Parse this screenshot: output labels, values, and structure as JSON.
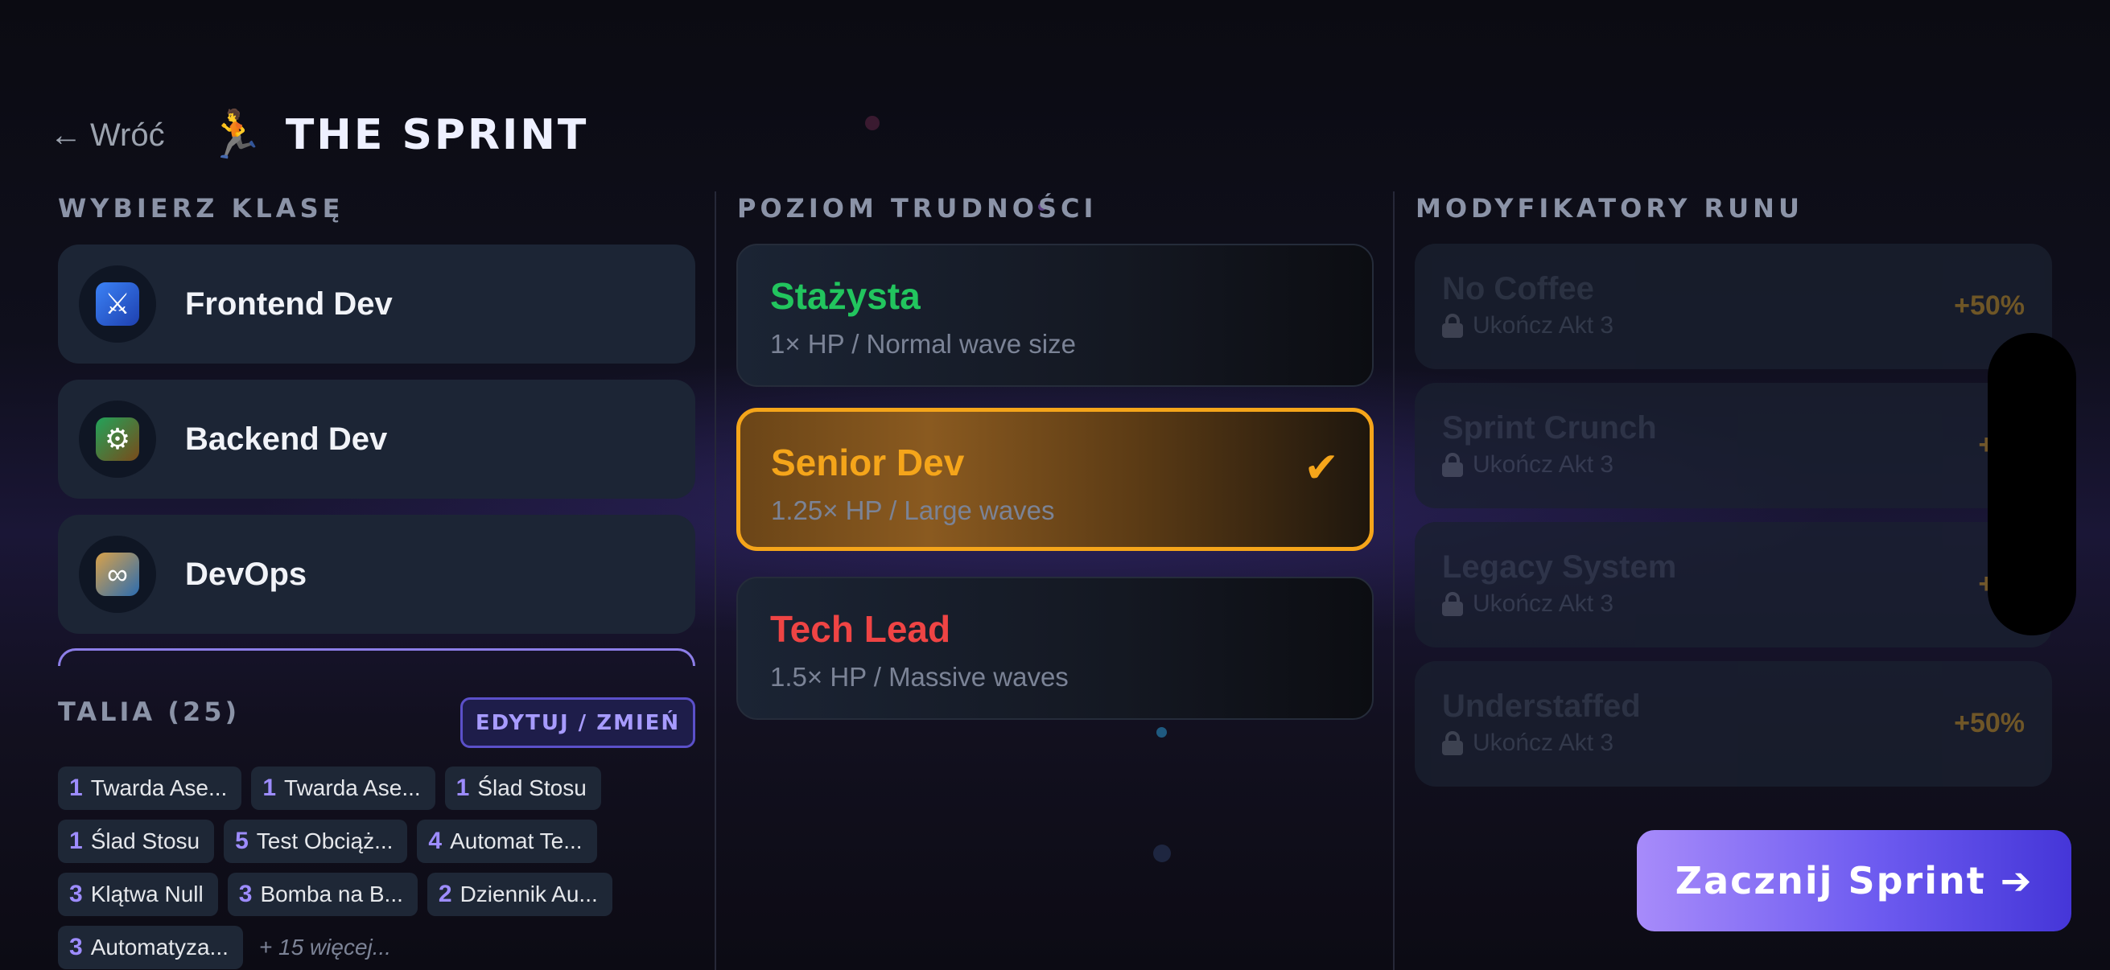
{
  "header": {
    "back_label": "Wróć",
    "back_arrow": "←",
    "runner_icon": "🏃",
    "title": "THE SPRINT"
  },
  "classes": {
    "heading": "WYBIERZ KLASĘ",
    "items": [
      {
        "name": "Frontend Dev",
        "icon": "sword-icon",
        "glyph": "⚔"
      },
      {
        "name": "Backend Dev",
        "icon": "gear-icon",
        "glyph": "⚙"
      },
      {
        "name": "DevOps",
        "icon": "infinity-icon",
        "glyph": "∞"
      }
    ]
  },
  "deck": {
    "title": "TALIA (25)",
    "edit_label": "EDYTUJ / ZMIEŃ",
    "rows": [
      [
        {
          "cost": "1",
          "name": "Twarda Ase..."
        },
        {
          "cost": "1",
          "name": "Twarda Ase..."
        },
        {
          "cost": "1",
          "name": "Ślad Stosu"
        }
      ],
      [
        {
          "cost": "1",
          "name": "Ślad Stosu"
        },
        {
          "cost": "5",
          "name": "Test Obciąż..."
        },
        {
          "cost": "4",
          "name": "Automat Te..."
        }
      ],
      [
        {
          "cost": "3",
          "name": "Klątwa Null"
        },
        {
          "cost": "3",
          "name": "Bomba na B..."
        },
        {
          "cost": "2",
          "name": "Dziennik Au..."
        }
      ],
      [
        {
          "cost": "3",
          "name": "Automatyza..."
        }
      ]
    ],
    "more": "+ 15 więcej..."
  },
  "difficulty": {
    "heading": "POZIOM TRUDNOŚCI",
    "items": [
      {
        "name": "Stażysta",
        "desc": "1× HP / Normal wave size",
        "color": "#22c55e"
      },
      {
        "name": "Senior Dev",
        "desc": "1.25× HP / Large waves",
        "color": "#f5a51a",
        "check": "✔"
      },
      {
        "name": "Tech Lead",
        "desc": "1.5× HP / Massive waves",
        "color": "#ef4444"
      }
    ]
  },
  "modifiers": {
    "heading": "MODYFIKATORY RUNU",
    "items": [
      {
        "name": "No Coffee",
        "lock": "Ukończ Akt 3",
        "bonus": "+50%"
      },
      {
        "name": "Sprint Crunch",
        "lock": "Ukończ Akt 3",
        "bonus": "+75"
      },
      {
        "name": "Legacy System",
        "lock": "Ukończ Akt 3",
        "bonus": "+25"
      },
      {
        "name": "Understaffed",
        "lock": "Ukończ Akt 3",
        "bonus": "+50%"
      }
    ]
  },
  "start_button": "Zacznij Sprint ➔",
  "colors": {
    "accent": "#f5a51a",
    "primary": "#6d5bf0"
  }
}
